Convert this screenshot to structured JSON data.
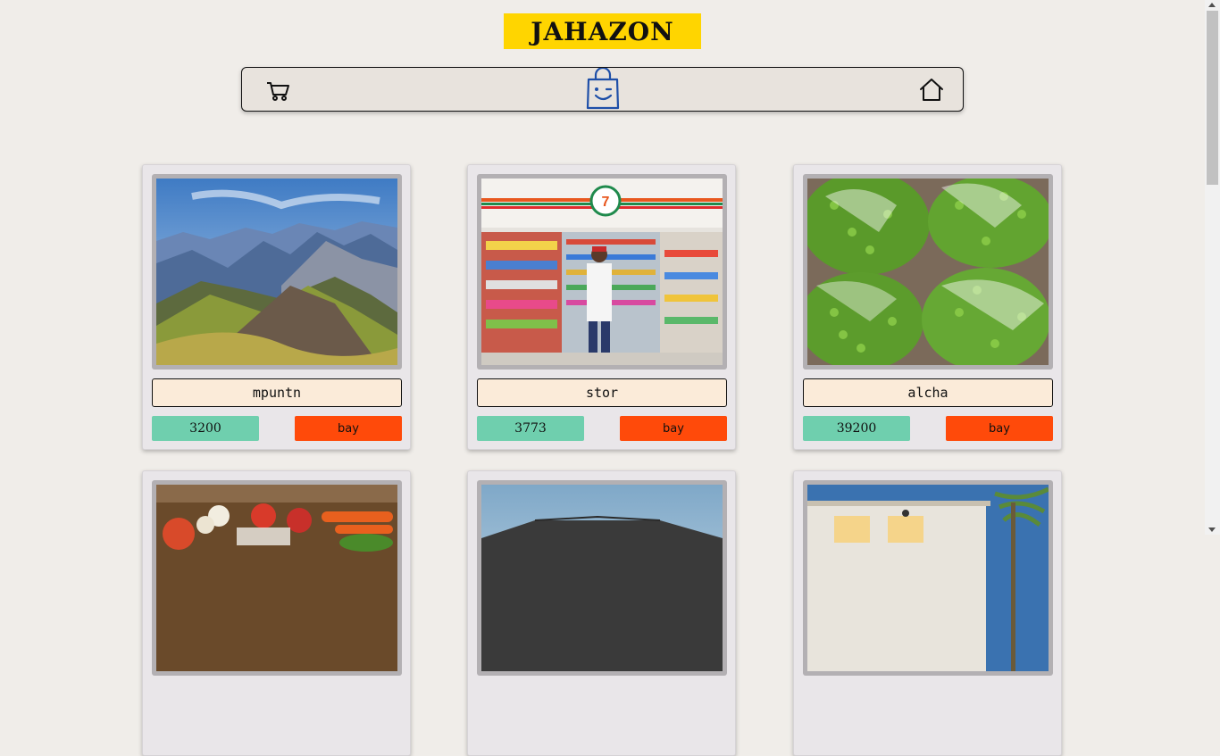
{
  "brand": {
    "title": "JAHAZON",
    "color": "#ffd500"
  },
  "nav": {
    "icons": [
      "cart-icon",
      "smiling-shopping-bag-icon",
      "home-icon"
    ],
    "accent": "#1e4fa8"
  },
  "products": [
    {
      "name": "mpuntn",
      "price": "3200",
      "buy_label": "bay",
      "image": "mountain-landscape-photo"
    },
    {
      "name": "stor",
      "price": "3773",
      "buy_label": "bay",
      "image": "convenience-store-interior-photo"
    },
    {
      "name": "alcha",
      "price": "39200",
      "buy_label": "bay",
      "image": "green-peas-in-bags-photo"
    },
    {
      "image": "vegetables-on-table-photo"
    },
    {
      "image": "house-exterior-photo"
    },
    {
      "image": "villa-with-palm-photo"
    }
  ],
  "colors": {
    "background": "#f0ede9",
    "price_bg": "#6fcfae",
    "buy_bg": "#ff4a0a",
    "name_bg": "#fbebd9"
  }
}
